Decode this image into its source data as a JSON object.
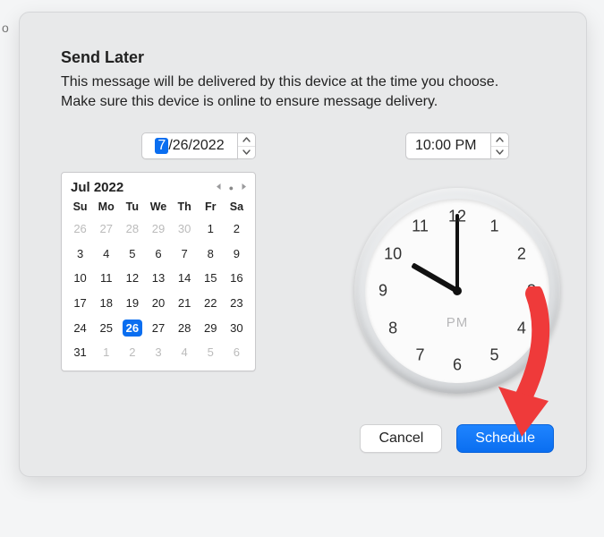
{
  "partial_outside_text": "o",
  "dialog": {
    "title": "Send Later",
    "description": "This message will be delivered by this device at the time you choose. Make sure this device is online to ensure message delivery."
  },
  "date_field": {
    "selected_part": "7",
    "rest": "/26/2022"
  },
  "time_field": {
    "value": "10:00 PM"
  },
  "calendar": {
    "month_label": "Jul 2022",
    "dow": [
      "Su",
      "Mo",
      "Tu",
      "We",
      "Th",
      "Fr",
      "Sa"
    ],
    "days": [
      {
        "n": "26",
        "outside": true
      },
      {
        "n": "27",
        "outside": true
      },
      {
        "n": "28",
        "outside": true
      },
      {
        "n": "29",
        "outside": true
      },
      {
        "n": "30",
        "outside": true
      },
      {
        "n": "1"
      },
      {
        "n": "2"
      },
      {
        "n": "3"
      },
      {
        "n": "4"
      },
      {
        "n": "5"
      },
      {
        "n": "6"
      },
      {
        "n": "7"
      },
      {
        "n": "8"
      },
      {
        "n": "9"
      },
      {
        "n": "10"
      },
      {
        "n": "11"
      },
      {
        "n": "12"
      },
      {
        "n": "13"
      },
      {
        "n": "14"
      },
      {
        "n": "15"
      },
      {
        "n": "16"
      },
      {
        "n": "17"
      },
      {
        "n": "18"
      },
      {
        "n": "19"
      },
      {
        "n": "20"
      },
      {
        "n": "21"
      },
      {
        "n": "22"
      },
      {
        "n": "23"
      },
      {
        "n": "24"
      },
      {
        "n": "25"
      },
      {
        "n": "26",
        "selected": true
      },
      {
        "n": "27"
      },
      {
        "n": "28"
      },
      {
        "n": "29"
      },
      {
        "n": "30"
      },
      {
        "n": "31"
      },
      {
        "n": "1",
        "outside": true
      },
      {
        "n": "2",
        "outside": true
      },
      {
        "n": "3",
        "outside": true
      },
      {
        "n": "4",
        "outside": true
      },
      {
        "n": "5",
        "outside": true
      },
      {
        "n": "6",
        "outside": true
      }
    ]
  },
  "clock": {
    "numbers": [
      "12",
      "1",
      "2",
      "3",
      "4",
      "5",
      "6",
      "7",
      "8",
      "9",
      "10",
      "11"
    ],
    "ampm": "PM"
  },
  "buttons": {
    "cancel": "Cancel",
    "schedule": "Schedule"
  }
}
